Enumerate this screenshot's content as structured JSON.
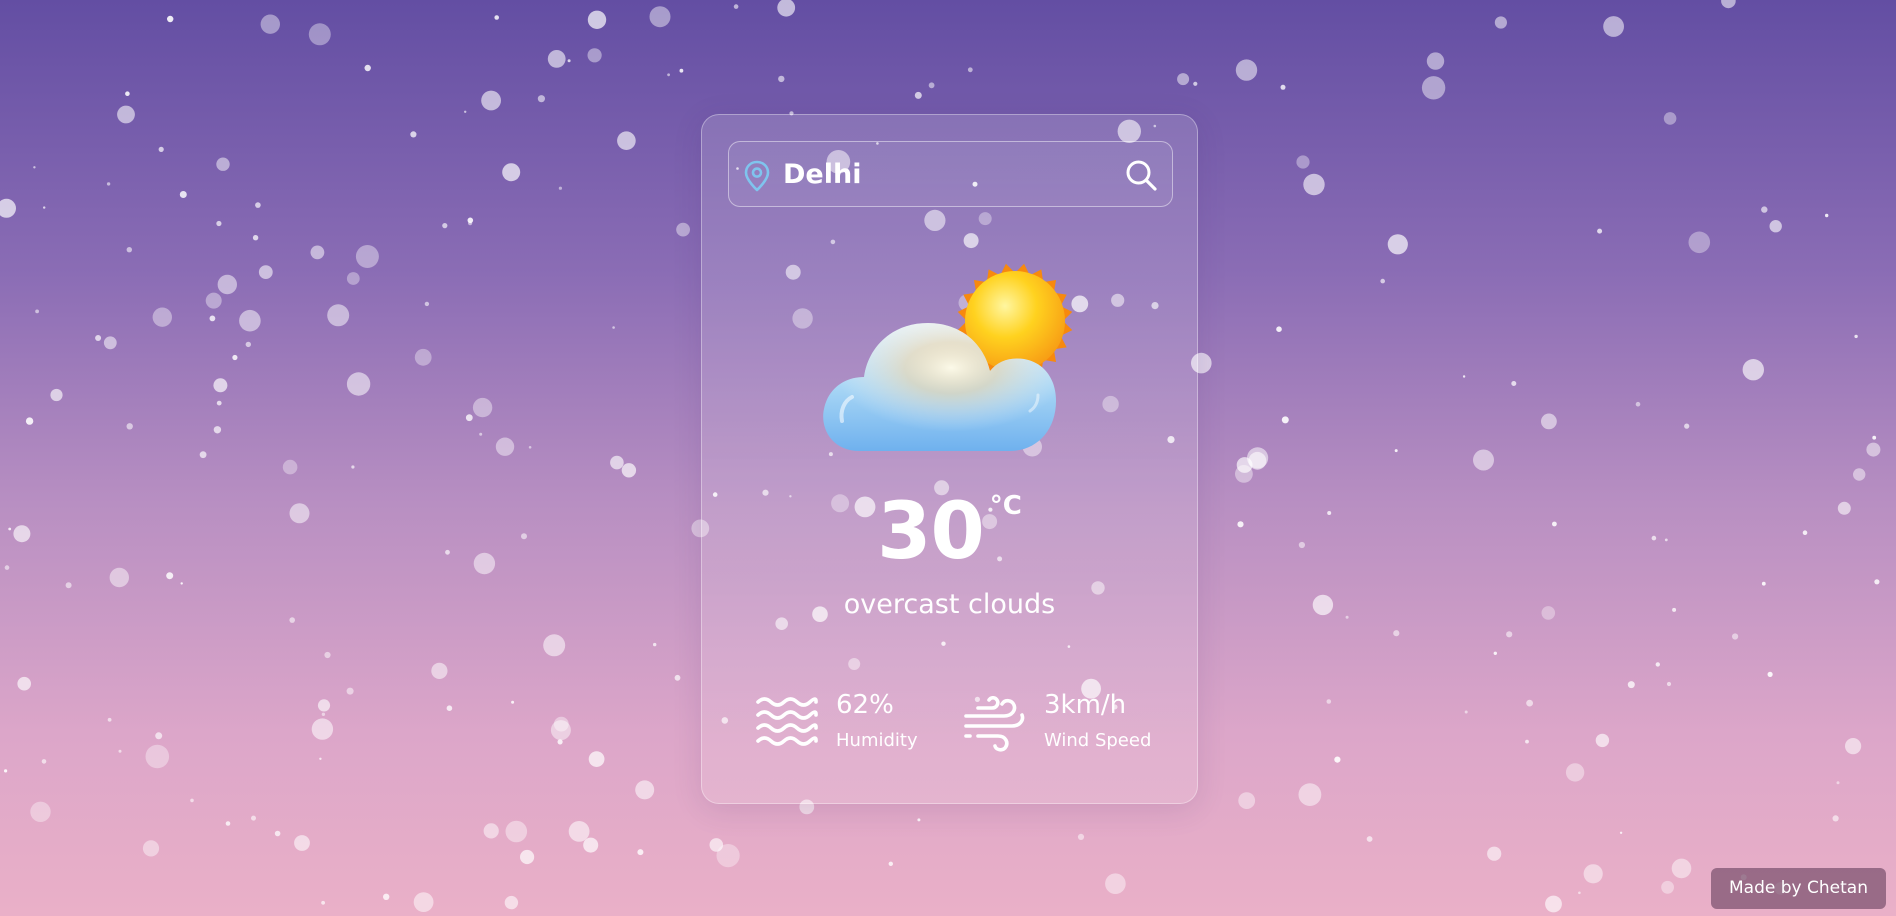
{
  "search": {
    "city_value": "Delhi",
    "pin_icon": "location-pin-icon",
    "search_icon": "search-icon"
  },
  "weather": {
    "icon": "partly-cloudy-icon",
    "temperature": "30",
    "unit": "°C",
    "description": "overcast clouds"
  },
  "details": {
    "humidity": {
      "icon": "humidity-waves-icon",
      "value": "62%",
      "label": "Humidity"
    },
    "wind": {
      "icon": "wind-icon",
      "value": "3km/h",
      "label": "Wind Speed"
    }
  },
  "footer": {
    "credit": "Made by Chetan"
  },
  "colors": {
    "background_top": "#634ea3",
    "background_bottom": "#eab0c8",
    "pin_accent": "#7fc4ee",
    "sun": "#f7a21a",
    "cloud": "#8cc6f2"
  }
}
